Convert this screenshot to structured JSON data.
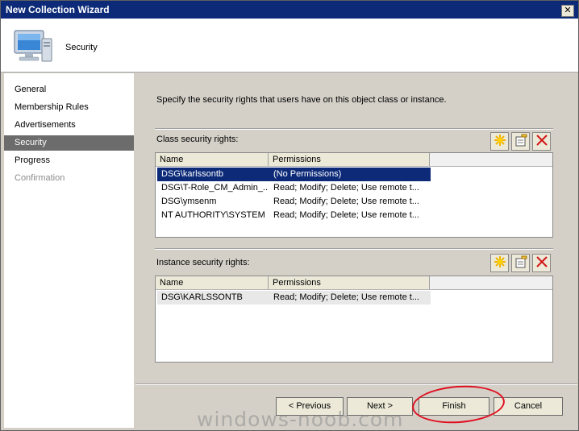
{
  "window": {
    "title": "New Collection Wizard",
    "close_glyph": "✕"
  },
  "header": {
    "page_title": "Security",
    "icon": "computer-icon"
  },
  "nav": {
    "items": [
      {
        "label": "General",
        "state": "normal"
      },
      {
        "label": "Membership Rules",
        "state": "normal"
      },
      {
        "label": "Advertisements",
        "state": "normal"
      },
      {
        "label": "Security",
        "state": "selected"
      },
      {
        "label": "Progress",
        "state": "normal"
      },
      {
        "label": "Confirmation",
        "state": "disabled"
      }
    ]
  },
  "content": {
    "instructions": "Specify the security rights that users have on this object class or instance.",
    "class_rights": {
      "label": "Class security rights:",
      "columns": [
        "Name",
        "Permissions"
      ],
      "rows": [
        {
          "name": "DSG\\karlssontb",
          "permissions": "(No Permissions)"
        },
        {
          "name": "DSG\\T-Role_CM_Admin_...",
          "permissions": "Read; Modify; Delete; Use remote t..."
        },
        {
          "name": "DSG\\ymsenm",
          "permissions": "Read; Modify; Delete; Use remote t..."
        },
        {
          "name": "NT AUTHORITY\\SYSTEM",
          "permissions": "Read; Modify; Delete; Use remote t..."
        }
      ],
      "selected_index": 0
    },
    "instance_rights": {
      "label": "Instance security rights:",
      "columns": [
        "Name",
        "Permissions"
      ],
      "rows": [
        {
          "name": "DSG\\KARLSSONTB",
          "permissions": "Read; Modify; Delete; Use remote t..."
        }
      ]
    },
    "toolbar_icons": [
      "new-icon",
      "properties-icon",
      "delete-icon"
    ]
  },
  "buttons": {
    "previous": "< Previous",
    "next": "Next >",
    "finish": "Finish",
    "cancel": "Cancel"
  },
  "colors": {
    "titlebar": "#0c2a78",
    "selection": "#0c2a78",
    "nav_selected": "#6c6c6c",
    "annotation": "#e01020"
  },
  "watermark": "windows-noob.com"
}
